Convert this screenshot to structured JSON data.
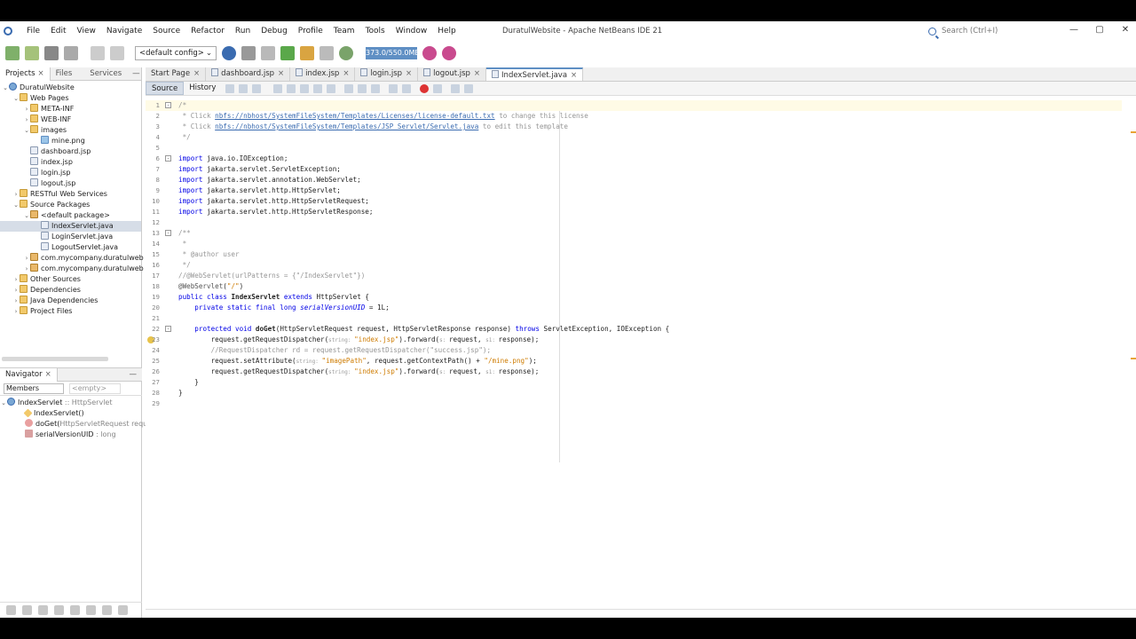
{
  "window": {
    "title": "DuratulWebsite - Apache NetBeans IDE 21"
  },
  "menu": [
    "File",
    "Edit",
    "View",
    "Navigate",
    "Source",
    "Refactor",
    "Run",
    "Debug",
    "Profile",
    "Team",
    "Tools",
    "Window",
    "Help"
  ],
  "search": {
    "placeholder": "Search (Ctrl+I)"
  },
  "window_controls": {
    "minimize": "—",
    "maximize": "▢",
    "close": "✕"
  },
  "toolbar": {
    "config": "<default config>",
    "memory": "373.0/550.0MB"
  },
  "left_tabs": [
    {
      "label": "Projects",
      "close": "×"
    },
    {
      "label": "Files"
    },
    {
      "label": "Services"
    }
  ],
  "minimize_glyph": "—",
  "project_tree": [
    {
      "label": "DuratulWebsite",
      "icon": "globe",
      "toggle": "⌄",
      "indent": 0
    },
    {
      "label": "Web Pages",
      "icon": "folder",
      "toggle": "⌄",
      "indent": 1
    },
    {
      "label": "META-INF",
      "icon": "folder",
      "toggle": "›",
      "indent": 2
    },
    {
      "label": "WEB-INF",
      "icon": "folder",
      "toggle": "›",
      "indent": 2
    },
    {
      "label": "images",
      "icon": "folder",
      "toggle": "⌄",
      "indent": 2
    },
    {
      "label": "mine.png",
      "icon": "img",
      "toggle": "",
      "indent": 3
    },
    {
      "label": "dashboard.jsp",
      "icon": "file",
      "toggle": "",
      "indent": 2
    },
    {
      "label": "index.jsp",
      "icon": "file",
      "toggle": "",
      "indent": 2
    },
    {
      "label": "login.jsp",
      "icon": "file",
      "toggle": "",
      "indent": 2
    },
    {
      "label": "logout.jsp",
      "icon": "file",
      "toggle": "",
      "indent": 2
    },
    {
      "label": "RESTful Web Services",
      "icon": "folder",
      "toggle": "›",
      "indent": 1
    },
    {
      "label": "Source Packages",
      "icon": "folder",
      "toggle": "⌄",
      "indent": 1
    },
    {
      "label": "<default package>",
      "icon": "pkg",
      "toggle": "⌄",
      "indent": 2
    },
    {
      "label": "IndexServlet.java",
      "icon": "file",
      "toggle": "",
      "indent": 3,
      "selected": true
    },
    {
      "label": "LoginServlet.java",
      "icon": "file",
      "toggle": "",
      "indent": 3
    },
    {
      "label": "LogoutServlet.java",
      "icon": "file",
      "toggle": "",
      "indent": 3
    },
    {
      "label": "com.mycompany.duratulweb",
      "icon": "pkg",
      "toggle": "›",
      "indent": 2
    },
    {
      "label": "com.mycompany.duratulweb",
      "icon": "pkg",
      "toggle": "›",
      "indent": 2
    },
    {
      "label": "Other Sources",
      "icon": "folder",
      "toggle": "›",
      "indent": 1
    },
    {
      "label": "Dependencies",
      "icon": "folder",
      "toggle": "›",
      "indent": 1
    },
    {
      "label": "Java Dependencies",
      "icon": "folder",
      "toggle": "›",
      "indent": 1
    },
    {
      "label": "Project Files",
      "icon": "folder",
      "toggle": "›",
      "indent": 1
    }
  ],
  "navigator": {
    "title": "Navigator",
    "close": "×",
    "members": "Members",
    "empty": "<empty>",
    "class_name": "IndexServlet",
    "class_ext": " :: HttpServlet",
    "items": [
      {
        "name": "IndexServlet()",
        "extra": ""
      },
      {
        "name": "doGet(",
        "extra": "HttpServletRequest request"
      },
      {
        "name": "serialVersionUID",
        "extra": " : long"
      }
    ]
  },
  "editor_tabs": [
    {
      "label": "Start Page",
      "close": "×"
    },
    {
      "label": "dashboard.jsp",
      "close": "×"
    },
    {
      "label": "index.jsp",
      "close": "×"
    },
    {
      "label": "login.jsp",
      "close": "×"
    },
    {
      "label": "logout.jsp",
      "close": "×"
    },
    {
      "label": "IndexServlet.java",
      "close": "×",
      "active": true
    }
  ],
  "editor_subtabs": {
    "source": "Source",
    "history": "History"
  },
  "code_lines": [
    {
      "n": "1",
      "html": "<span class='cm'>/*</span>",
      "fold": "-"
    },
    {
      "n": "2",
      "html": "<span class='cm'> * Click </span><span class='lnk'>nbfs://nbhost/SystemFileSystem/Templates/Licenses/license-default.txt</span><span class='cm'> to change this license</span>"
    },
    {
      "n": "3",
      "html": "<span class='cm'> * Click </span><span class='lnk'>nbfs://nbhost/SystemFileSystem/Templates/JSP_Servlet/Servlet.java</span><span class='cm'> to edit this template</span>"
    },
    {
      "n": "4",
      "html": "<span class='cm'> */</span>"
    },
    {
      "n": "5",
      "html": ""
    },
    {
      "n": "6",
      "html": "<span class='kw'>import</span> java.io.IOException;",
      "fold": "-"
    },
    {
      "n": "7",
      "html": "<span class='kw'>import</span> jakarta.servlet.ServletException;"
    },
    {
      "n": "8",
      "html": "<span class='kw'>import</span> jakarta.servlet.annotation.WebServlet;"
    },
    {
      "n": "9",
      "html": "<span class='kw'>import</span> jakarta.servlet.http.HttpServlet;"
    },
    {
      "n": "10",
      "html": "<span class='kw'>import</span> jakarta.servlet.http.HttpServletRequest;"
    },
    {
      "n": "11",
      "html": "<span class='kw'>import</span> jakarta.servlet.http.HttpServletResponse;"
    },
    {
      "n": "12",
      "html": ""
    },
    {
      "n": "13",
      "html": "<span class='cm'>/**</span>",
      "fold": "-"
    },
    {
      "n": "14",
      "html": "<span class='cm'> *</span>"
    },
    {
      "n": "15",
      "html": "<span class='cm'> * @author user</span>"
    },
    {
      "n": "16",
      "html": "<span class='cm'> */</span>"
    },
    {
      "n": "17",
      "html": "<span class='cm'>//@WebServlet(urlPatterns = {\"/IndexServlet\"})</span>"
    },
    {
      "n": "18",
      "html": "<span class='anno'>@WebServlet</span>(<span class='str'>\"/\"</span>)"
    },
    {
      "n": "19",
      "html": "<span class='kw'>public class</span> <span class='bold'>IndexServlet</span> <span class='kw'>extends</span> HttpServlet {"
    },
    {
      "n": "20",
      "html": "    <span class='kw'>private static final long</span> <span class='it'>serialVersionUID</span> = 1L;"
    },
    {
      "n": "21",
      "html": ""
    },
    {
      "n": "22",
      "html": "    <span class='kw'>protected void</span> <span class='bold'>doGet</span>(HttpServletRequest request, HttpServletResponse response) <span class='kw'>throws</span> ServletException, IOException {",
      "fold": "-"
    },
    {
      "n": "23",
      "html": "        request.getRequestDispatcher(<span class='hint'>string: </span><span class='str'>\"index.jsp\"</span>).forward(<span class='hint'>s: </span>request, <span class='hint'>s1: </span>response);"
    },
    {
      "n": "24",
      "html": "        <span class='cm'>//RequestDispatcher rd = request.getRequestDispatcher(\"success.jsp\");</span>"
    },
    {
      "n": "25",
      "html": "        request.setAttribute(<span class='hint'>string: </span><span class='str'>\"imagePath\"</span>, request.getContextPath() + <span class='str'>\"/mine.png\"</span>);"
    },
    {
      "n": "26",
      "html": "        request.getRequestDispatcher(<span class='hint'>string: </span><span class='str'>\"index.jsp\"</span>).forward(<span class='hint'>s: </span>request, <span class='hint'>s1: </span>response);"
    },
    {
      "n": "27",
      "html": "    }"
    },
    {
      "n": "28",
      "html": "}"
    },
    {
      "n": "29",
      "html": ""
    }
  ]
}
